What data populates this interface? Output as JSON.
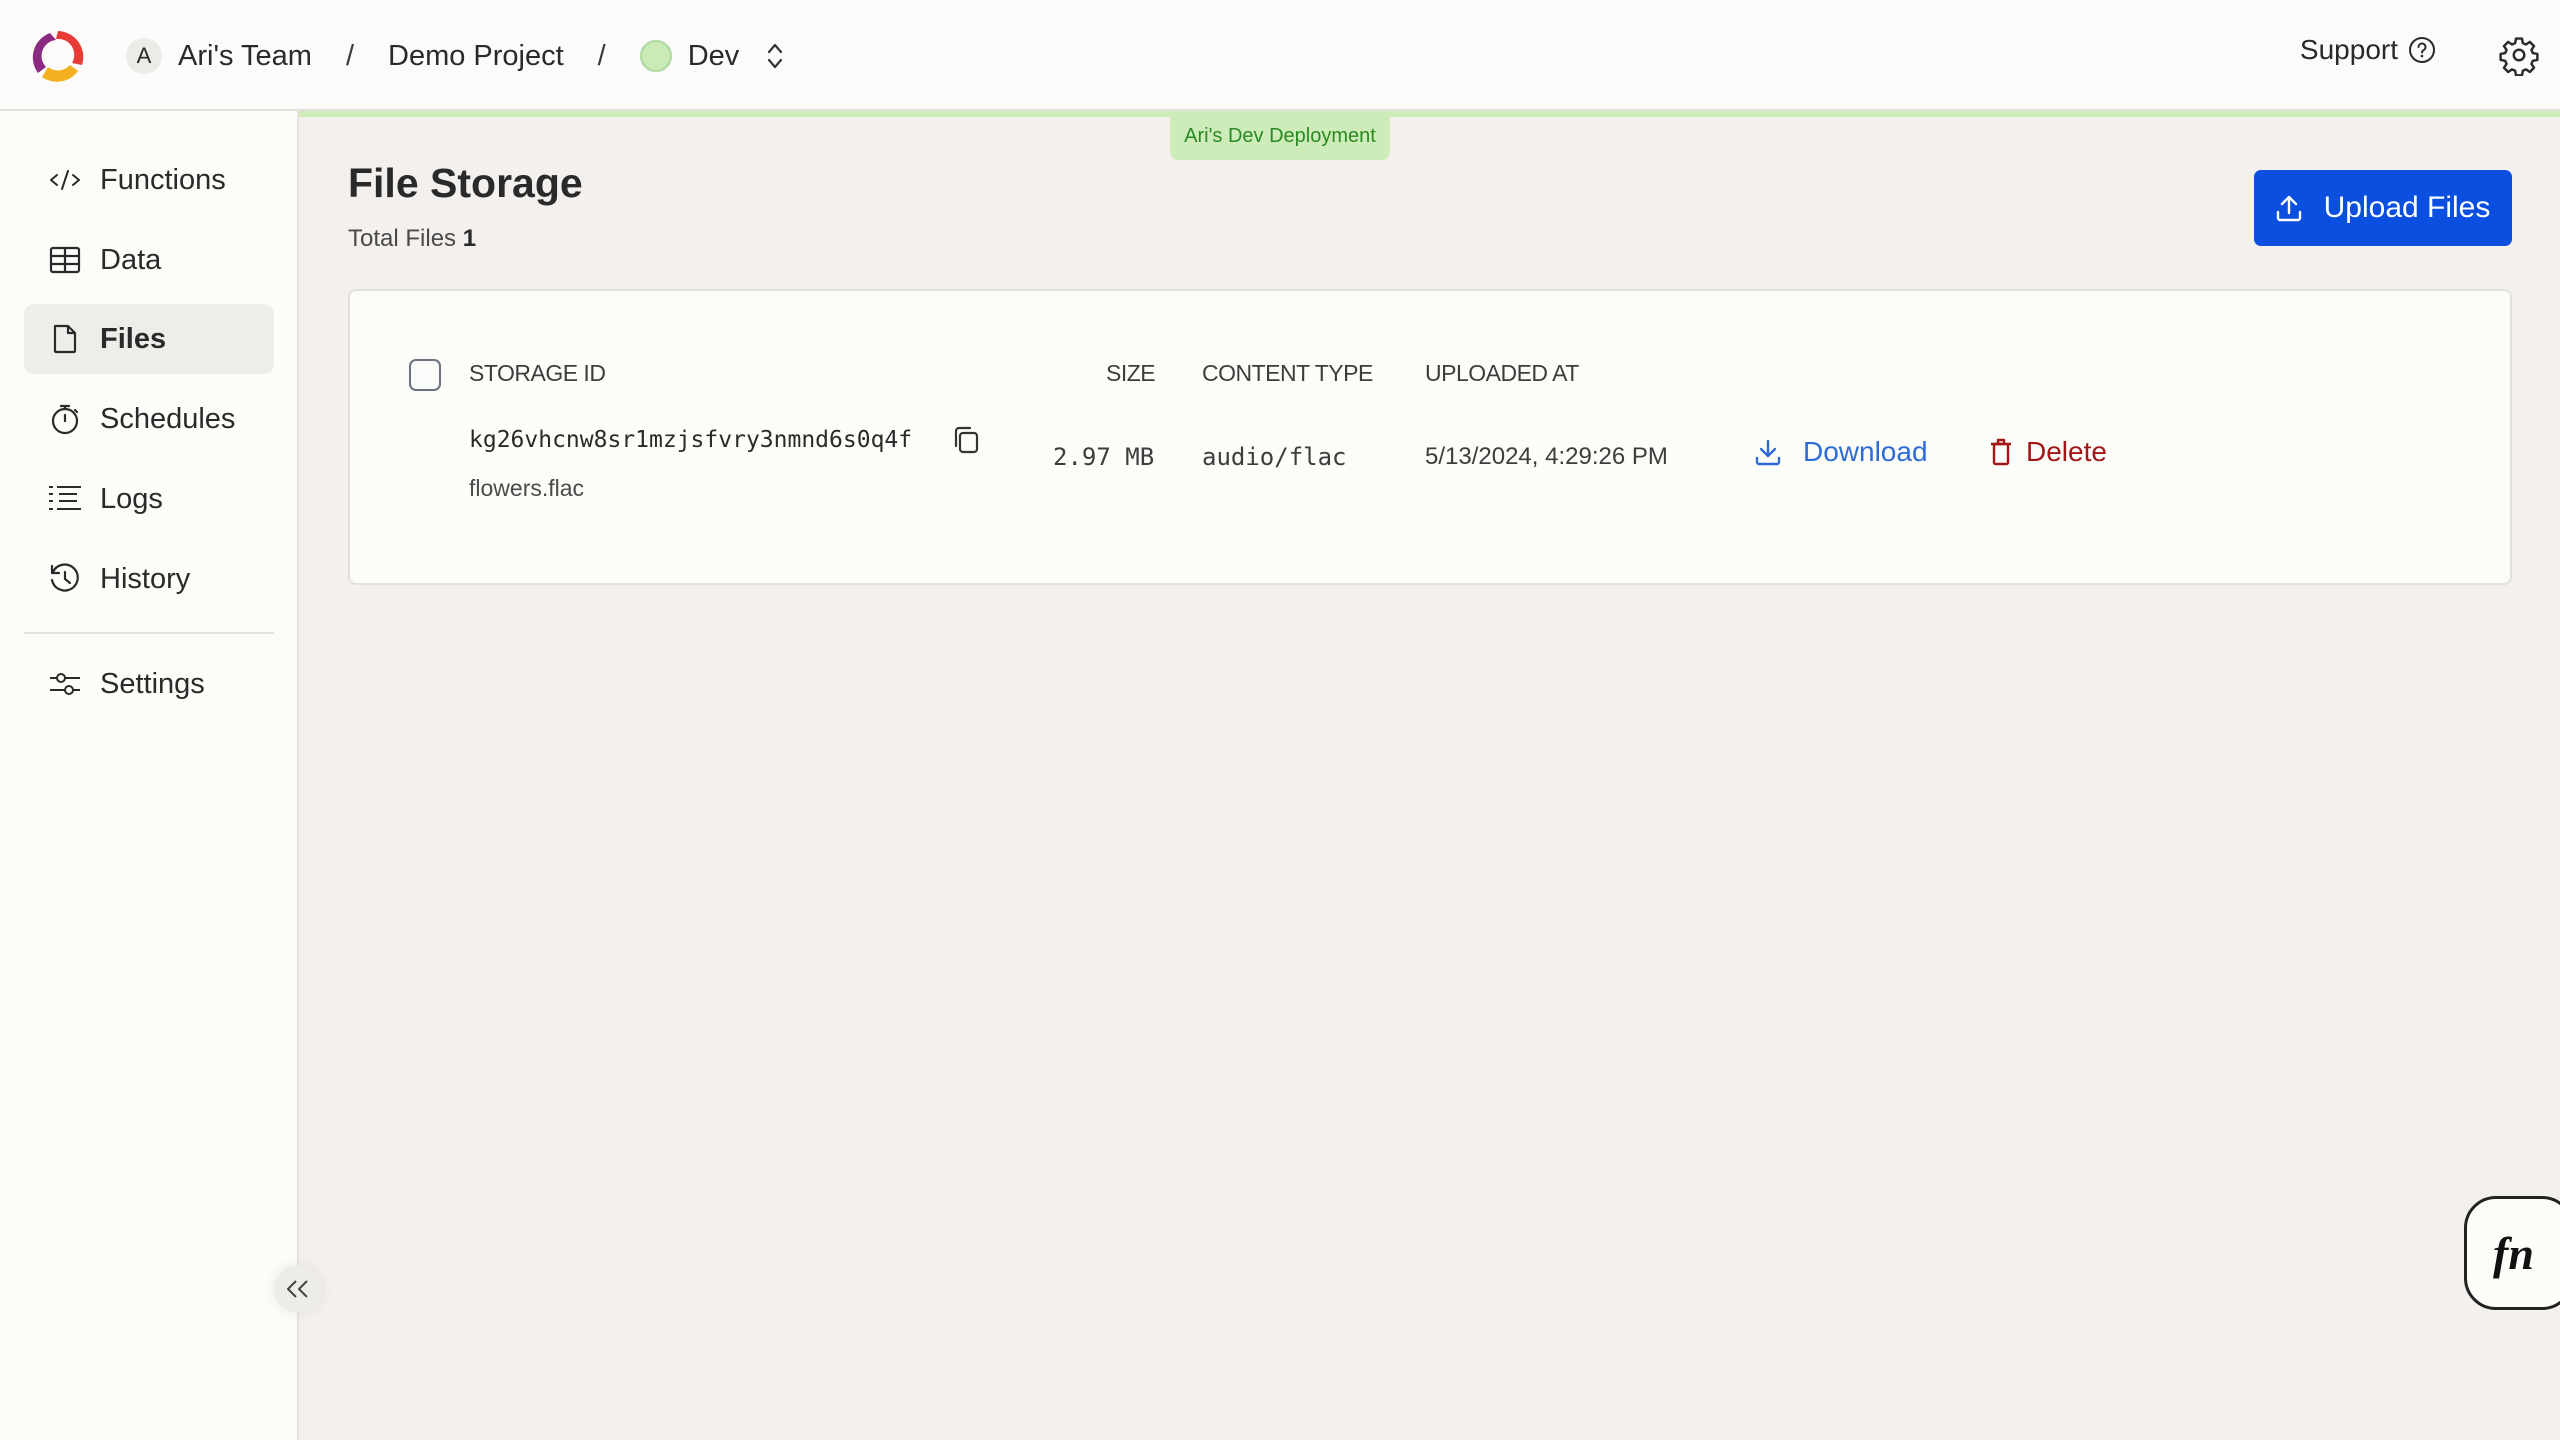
{
  "header": {
    "team_initial": "A",
    "team_name": "Ari's Team",
    "separator": "/",
    "project_name": "Demo Project",
    "deployment_name": "Dev",
    "deployment_color": "#c9ebb6",
    "support_label": "Support"
  },
  "deployment_badge": {
    "label": "Ari's Dev Deployment",
    "color": "#cdecb9"
  },
  "sidebar": {
    "items": [
      {
        "id": "functions",
        "label": "Functions",
        "icon": "code-icon",
        "active": false
      },
      {
        "id": "data",
        "label": "Data",
        "icon": "table-icon",
        "active": false
      },
      {
        "id": "files",
        "label": "Files",
        "icon": "file-icon",
        "active": true
      },
      {
        "id": "schedules",
        "label": "Schedules",
        "icon": "stopwatch-icon",
        "active": false
      },
      {
        "id": "logs",
        "label": "Logs",
        "icon": "logs-icon",
        "active": false
      },
      {
        "id": "history",
        "label": "History",
        "icon": "history-icon",
        "active": false
      }
    ],
    "settings": {
      "id": "settings",
      "label": "Settings",
      "icon": "sliders-icon"
    }
  },
  "main": {
    "title": "File Storage",
    "total_files_label": "Total Files",
    "total_files_count": "1",
    "upload_button_label": "Upload Files",
    "accent_color": "#0a4fe0",
    "table": {
      "columns": [
        "STORAGE ID",
        "SIZE",
        "CONTENT TYPE",
        "UPLOADED AT"
      ],
      "rows": [
        {
          "storage_id": "kg26vhcnw8sr1mzjsfvry3nmnd6s0q4f",
          "file_name": "flowers.flac",
          "size": "2.97 MB",
          "content_type": "audio/flac",
          "uploaded_at": "5/13/2024, 4:29:26 PM",
          "download_label": "Download",
          "delete_label": "Delete"
        }
      ]
    }
  },
  "fn_button": {
    "label": "fn"
  }
}
